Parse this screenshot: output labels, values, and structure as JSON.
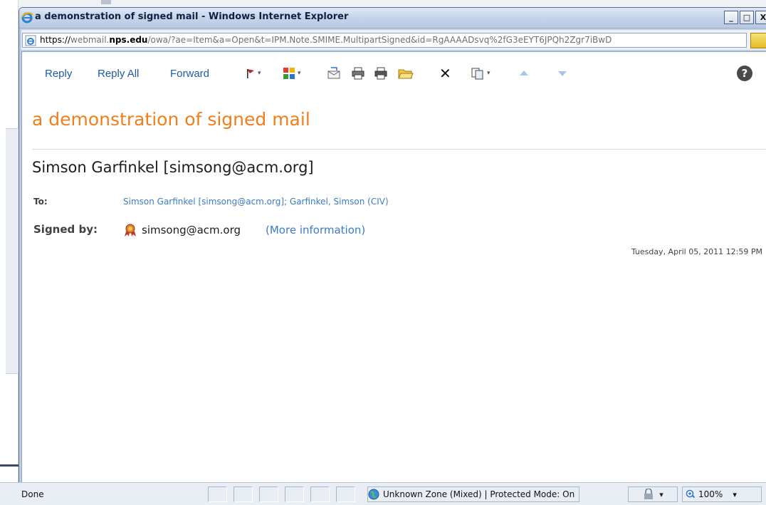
{
  "window": {
    "title": "a demonstration of signed mail - Windows Internet Explorer",
    "minimize_label": "_",
    "maximize_label": "□",
    "close_label": "X"
  },
  "address_bar": {
    "url_scheme": "https://",
    "url_host_prefix": "webmail.",
    "url_domain": "nps.edu",
    "url_rest": "/owa/?ae=Item&a=Open&t=IPM.Note.SMIME.MultipartSigned&id=RgAAAADsvq%2fG3eEYT6JPQh2Zgr7iBwD",
    "icon": "ie-page-icon"
  },
  "toolbar": {
    "reply_label": "Reply",
    "reply_all_label": "Reply All",
    "forward_label": "Forward",
    "icons": [
      "flag-icon",
      "categories-icon",
      "move-to-folder-icon",
      "print-icon",
      "print-preview-icon",
      "open-folder-icon",
      "delete-icon",
      "copy-icon",
      "previous-item-icon",
      "next-item-icon",
      "help-icon"
    ],
    "delete_glyph": "✕",
    "help_glyph": "?"
  },
  "message": {
    "subject": "a demonstration of signed mail",
    "sender": "Simson Garfinkel [simsong@acm.org]",
    "to_label": "To:",
    "to_value": "Simson Garfinkel [simsong@acm.org]; Garfinkel, Simson (CIV)",
    "signed_label": "Signed by:",
    "signed_address": "simsong@acm.org",
    "more_info_open": "(",
    "more_info_link": "More information",
    "more_info_close": ")",
    "date": "Tuesday, April 05, 2011 12:59 PM"
  },
  "statusbar": {
    "status": "Done",
    "zone": "Unknown Zone (Mixed) | Protected Mode: On",
    "zoom": "100%"
  },
  "colors": {
    "subject": "#f07e1a",
    "link": "#1e5aa8",
    "to_link": "#3a7bc8",
    "titlebar": "#c4d4ea"
  }
}
